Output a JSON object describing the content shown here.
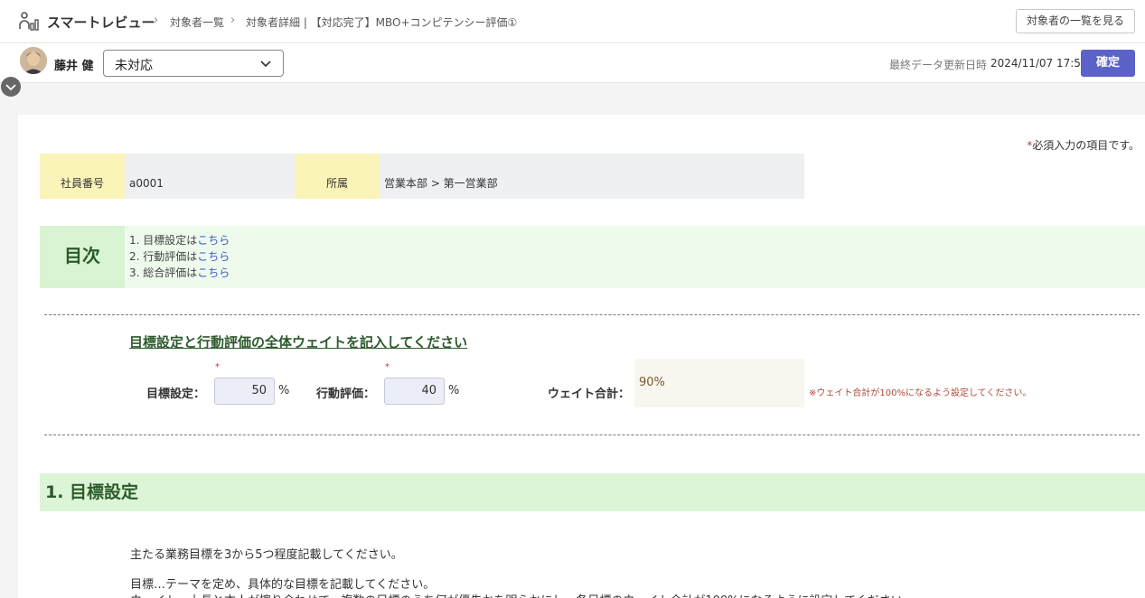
{
  "header": {
    "app_title": "スマートレビュー",
    "breadcrumbs": [
      "対象者一覧",
      "対象者詳細 | 【対応完了】MBO+コンピテンシー評価①"
    ],
    "list_button": "対象者の一覧を見る"
  },
  "subject": {
    "name": "藤井 健",
    "status": "未対応",
    "updated_label": "最終データ更新日時",
    "updated_value": "2024/11/07 17:50",
    "confirm_button": "確定"
  },
  "form": {
    "required_star": "*",
    "required_note": "必須入力の項目です。",
    "info": {
      "employee_no_label": "社員番号",
      "employee_no": "a0001",
      "dept_label": "所属",
      "dept": "営業本部 > 第一営業部"
    },
    "toc": {
      "heading": "目次",
      "items": [
        {
          "prefix": "1. 目標設定は",
          "link": "こちら"
        },
        {
          "prefix": "2. 行動評価は",
          "link": "こちら"
        },
        {
          "prefix": "3. 総合評価は",
          "link": "こちら"
        }
      ]
    },
    "weights": {
      "title": "目標設定と行動評価の全体ウェイトを記入してください",
      "goal_label": "目標設定：",
      "goal_value": "50",
      "behavior_label": "行動評価：",
      "behavior_value": "40",
      "percent": "%",
      "total_label": "ウェイト合計：",
      "total_value": "90%",
      "note": "※ウェイト合計が100%になるよう設定してください。"
    },
    "section1": {
      "heading": "1. 目標設定",
      "lines": [
        "主たる業務目標を3から5つ程度記載してください。",
        "目標…テーマを定め、具体的な目標を記載してください。",
        "ウェイト…上長と本人が擦り合わせて、複数の目標のうち何が優先かを明らかにし、各目標のウェイト合計が100%になるように設定してください。"
      ]
    }
  },
  "colors": {
    "accent": "#5b63c8",
    "section_green": "#dcf5d6",
    "label_yellow": "#fbf4b9",
    "link": "#3a56c5"
  }
}
